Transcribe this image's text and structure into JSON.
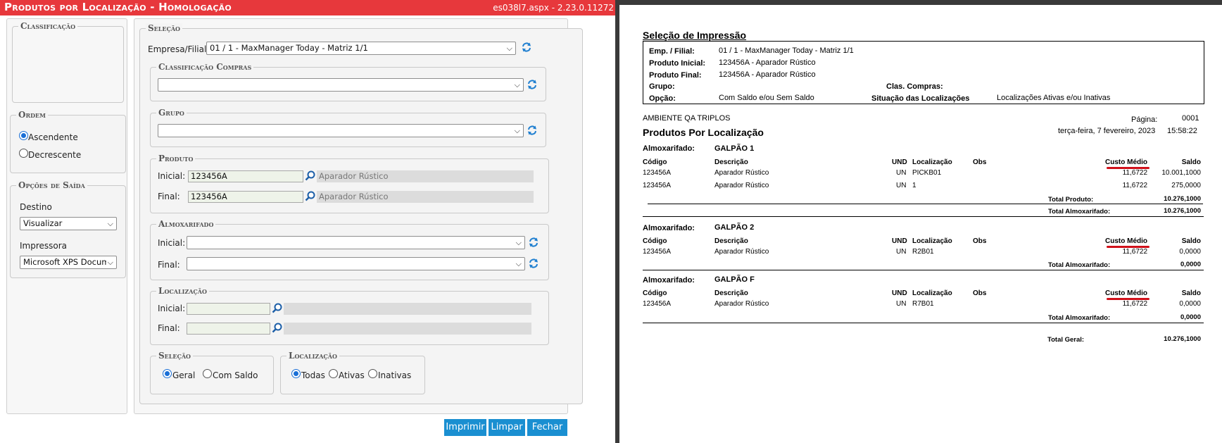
{
  "app": {
    "title": "Produtos por Localização  - Homologação",
    "version": "es038l7.aspx - 2.23.0.11272"
  },
  "classificacao": {
    "legend": "Classificação"
  },
  "ordem": {
    "legend": "Ordem",
    "options": [
      {
        "label": "Ascendente",
        "selected": true
      },
      {
        "label": "Decrescente",
        "selected": false
      }
    ]
  },
  "opcoes_saida": {
    "legend": "Opções de Saída",
    "destino_label": "Destino",
    "destino_value": "Visualizar",
    "impressora_label": "Impressora",
    "impressora_value": "Microsoft XPS Docum"
  },
  "selecao": {
    "legend": "Seleção",
    "empresa_label": "Empresa/Filial:",
    "empresa_value": "01 / 1 - MaxManager Today - Matriz 1/1",
    "classificacao_compras": {
      "legend": "Classificação Compras",
      "value": ""
    },
    "grupo": {
      "legend": "Grupo",
      "value": ""
    },
    "produto": {
      "legend": "Produto",
      "inicial_label": "Inicial:",
      "inicial_code": "123456A",
      "inicial_desc": "Aparador Rústico",
      "final_label": "Final:",
      "final_code": "123456A",
      "final_desc": "Aparador Rústico"
    },
    "almoxarifado": {
      "legend": "Almoxarifado",
      "inicial_label": "Inicial:",
      "final_label": "Final:"
    },
    "localizacao": {
      "legend": "Localização",
      "inicial_label": "Inicial:",
      "final_label": "Final:"
    },
    "selecao_radio": {
      "legend": "Seleção",
      "options": [
        {
          "label": "Geral",
          "selected": true
        },
        {
          "label": "Com Saldo",
          "selected": false
        }
      ]
    },
    "localizacao_radio": {
      "legend": "Localização",
      "options": [
        {
          "label": "Todas",
          "selected": true
        },
        {
          "label": "Ativas",
          "selected": false
        },
        {
          "label": "Inativas",
          "selected": false
        }
      ]
    }
  },
  "buttons": {
    "imprimir": "Imprimir",
    "limpar": "Limpar",
    "fechar": "Fechar"
  },
  "icons": {
    "search": "search-icon",
    "refresh": "refresh-icon",
    "dropdown": "chevron-down-icon"
  },
  "colors": {
    "title_bar": "#e7383c",
    "button": "#1a8fd1",
    "underline": "#d0101a"
  },
  "report": {
    "heading": "Seleção de Impressão",
    "box": {
      "emp_label": "Emp. / Filial:",
      "emp_value": "01 / 1 - MaxManager Today - Matriz 1/1",
      "prod_ini_label": "Produto Inicial:",
      "prod_ini_value": "123456A - Aparador Rústico",
      "prod_fin_label": "Produto Final:",
      "prod_fin_value": "123456A - Aparador Rústico",
      "grupo_label": "Grupo:",
      "clas_label": "Clas. Compras:",
      "opcao_label": "Opção:",
      "opcao_value": "Com Saldo e/ou Sem Saldo",
      "sit_label": "Situação das Localizações",
      "sit_value": "Localizações Ativas e/ou Inativas"
    },
    "ambiente": "AMBIENTE QA TRIPLOS",
    "title": "Produtos Por Localização",
    "pagina_label": "Página:",
    "pagina_value": "0001",
    "date": "terça-feira, 7 fevereiro, 2023",
    "time": "15:58:22",
    "almox_label": "Almoxarifado:",
    "columns": {
      "codigo": "Código",
      "descricao": "Descrição",
      "und": "UND",
      "localizacao": "Localização",
      "obs": "Obs",
      "custo": "Custo Médio",
      "saldo": "Saldo"
    },
    "galpao1": {
      "name": "GALPÃO 1",
      "rows": [
        {
          "codigo": "123456A",
          "descricao": "Aparador Rústico",
          "und": "UN",
          "loc": "PICKB01",
          "custo": "11,6722",
          "saldo": "10.001,1000"
        },
        {
          "codigo": "123456A",
          "descricao": "Aparador Rústico",
          "und": "UN",
          "loc": "1",
          "custo": "11,6722",
          "saldo": "275,0000"
        }
      ],
      "total_produto_label": "Total Produto:",
      "total_produto": "10.276,1000",
      "total_almox_label": "Total Almoxarifado:",
      "total_almox": "10.276,1000"
    },
    "galpao2": {
      "name": "GALPÃO 2",
      "rows": [
        {
          "codigo": "123456A",
          "descricao": "Aparador Rústico",
          "und": "UN",
          "loc": "R2B01",
          "custo": "11,6722",
          "saldo": "0,0000"
        }
      ],
      "total_almox_label": "Total Almoxarifado:",
      "total_almox": "0,0000"
    },
    "galpaoF": {
      "name": "GALPÃO F",
      "rows": [
        {
          "codigo": "123456A",
          "descricao": "Aparador Rústico",
          "und": "UN",
          "loc": "R7B01",
          "custo": "11,6722",
          "saldo": "0,0000"
        }
      ],
      "total_almox_label": "Total Almoxarifado:",
      "total_almox": "0,0000"
    },
    "total_geral_label": "Total Geral:",
    "total_geral": "10.276,1000"
  }
}
